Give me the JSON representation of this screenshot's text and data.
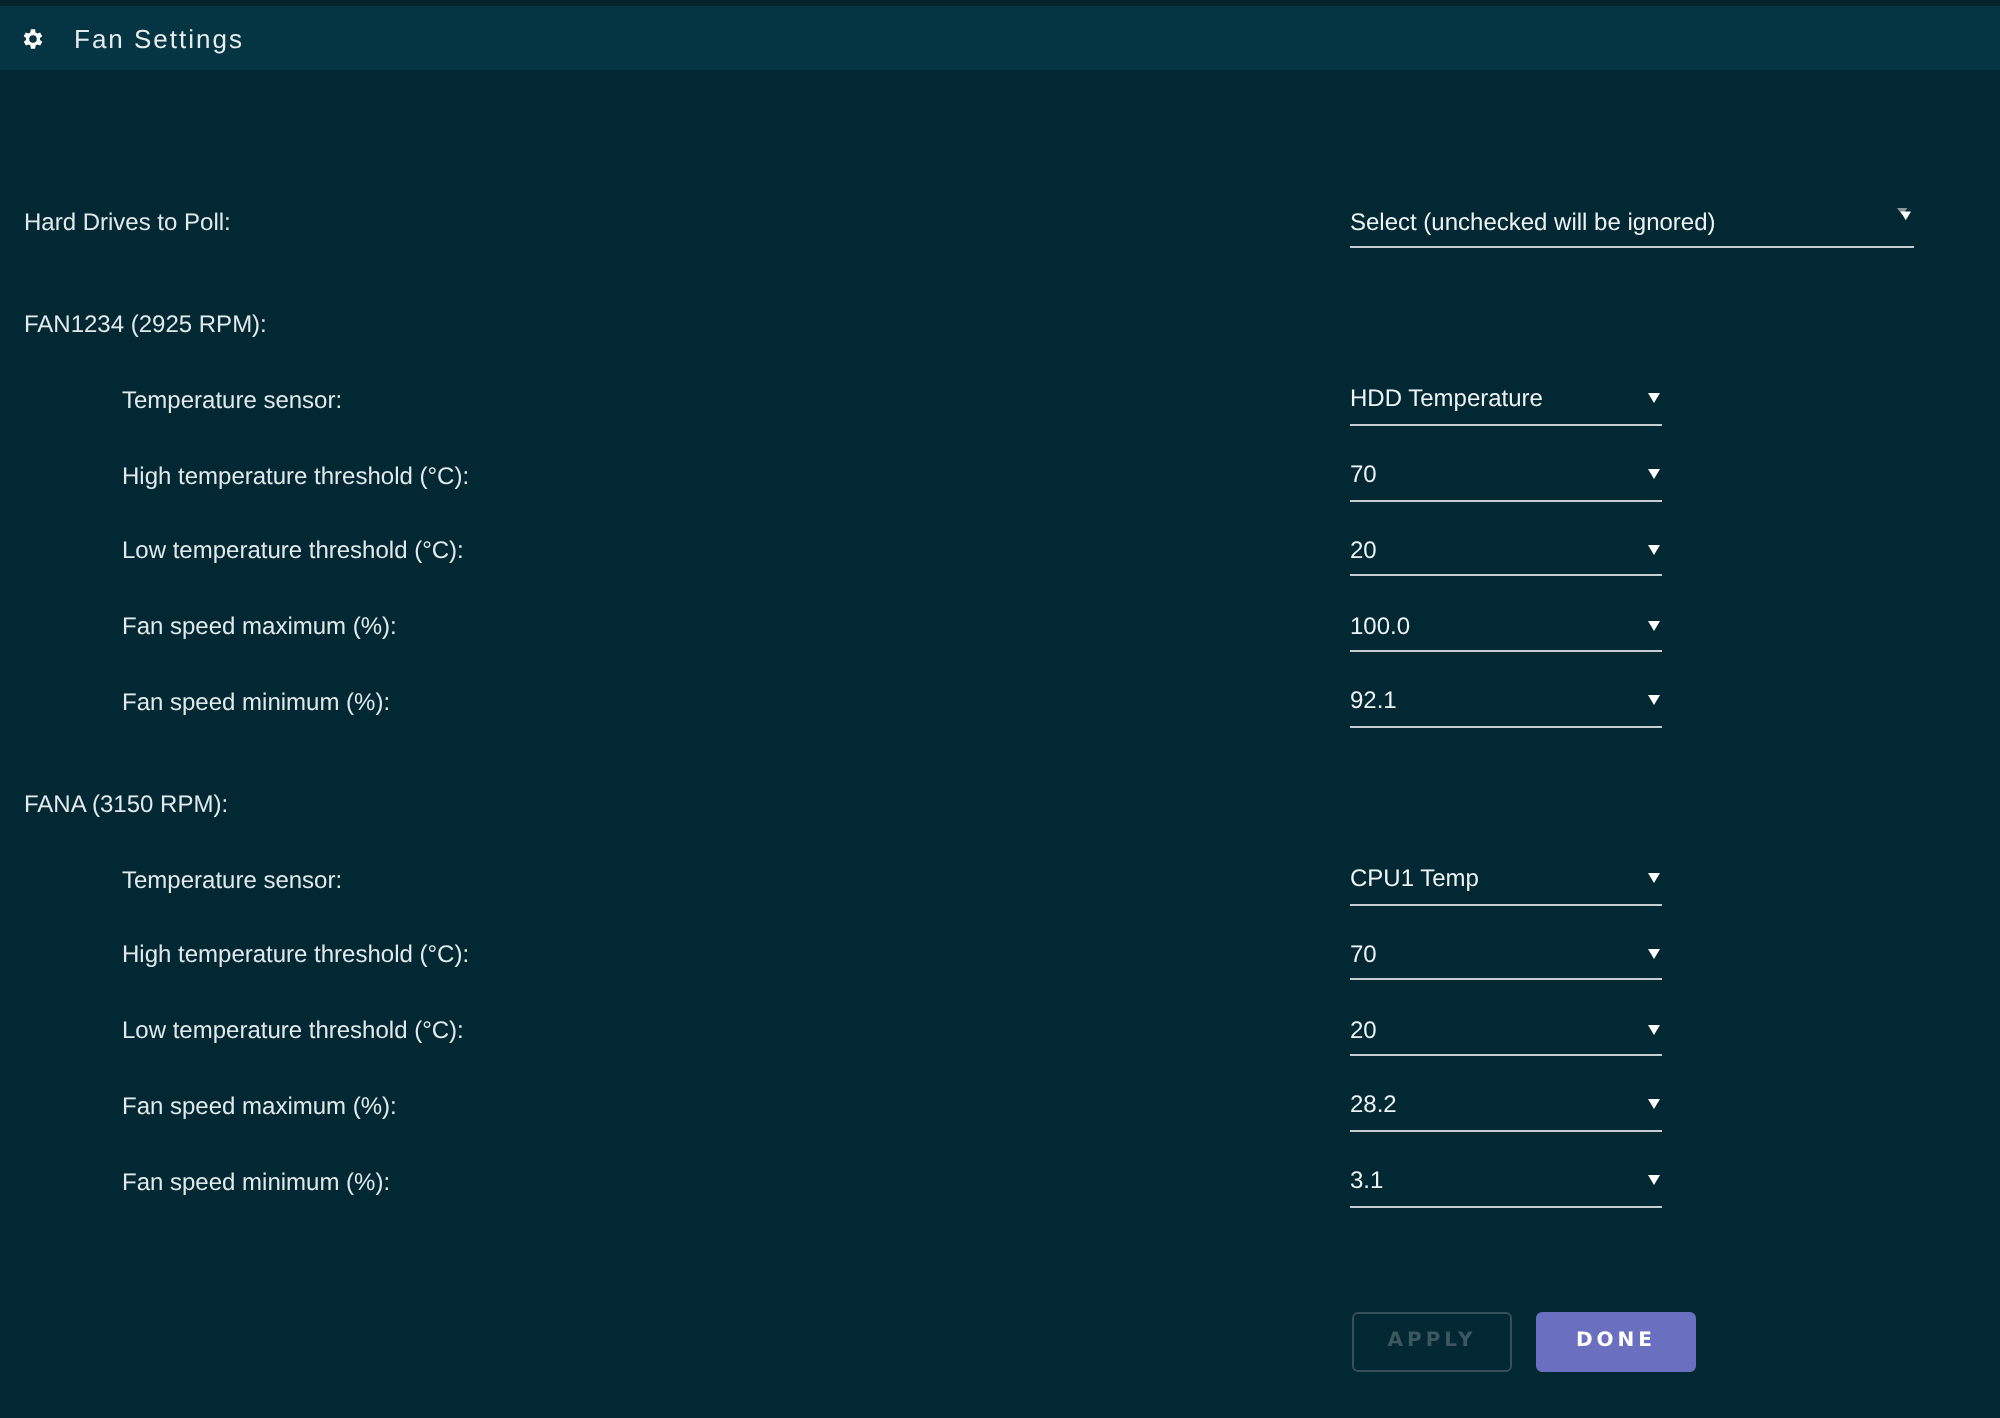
{
  "header": {
    "title": "Fan Settings"
  },
  "drive_poll": {
    "label": "Hard Drives to Poll:",
    "placeholder": "Select (unchecked will be ignored)"
  },
  "fans": [
    {
      "title": "FAN1234 (2925 RPM):",
      "settings": [
        {
          "label": "Temperature sensor:",
          "value": "HDD Temperature"
        },
        {
          "label": "High temperature threshold (°C):",
          "value": "70"
        },
        {
          "label": "Low temperature threshold (°C):",
          "value": "20"
        },
        {
          "label": "Fan speed maximum (%):",
          "value": "100.0"
        },
        {
          "label": "Fan speed minimum (%):",
          "value": "92.1"
        }
      ]
    },
    {
      "title": "FANA (3150 RPM):",
      "settings": [
        {
          "label": "Temperature sensor:",
          "value": "CPU1 Temp"
        },
        {
          "label": "High temperature threshold (°C):",
          "value": "70"
        },
        {
          "label": "Low temperature threshold (°C):",
          "value": "20"
        },
        {
          "label": "Fan speed maximum (%):",
          "value": "28.2"
        },
        {
          "label": "Fan speed minimum (%):",
          "value": "3.1"
        }
      ]
    }
  ],
  "buttons": [
    {
      "label": "APPLY",
      "disabled": true
    },
    {
      "label": "DONE",
      "disabled": false
    }
  ]
}
